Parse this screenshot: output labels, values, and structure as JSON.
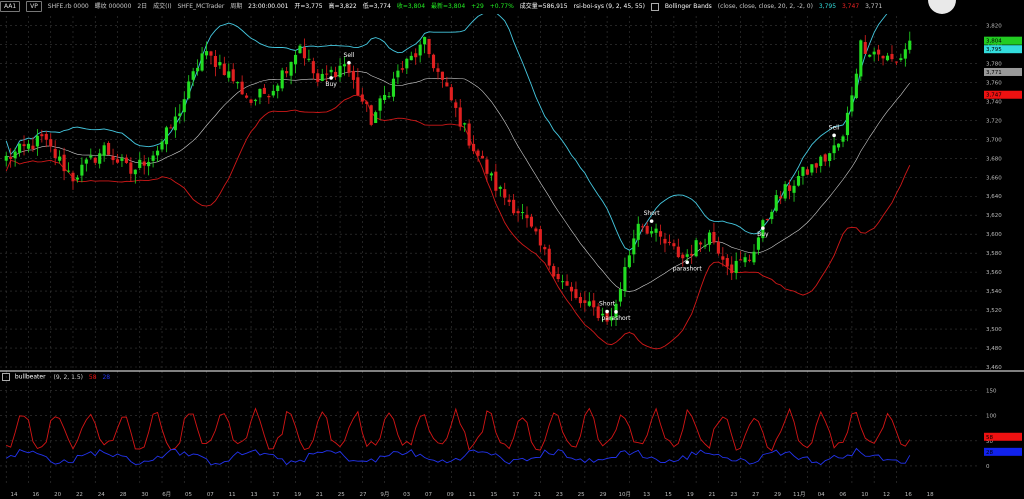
{
  "header": {
    "symbol_chip": "AA1",
    "vp_chip": "VP",
    "contract": "SHFE.rb 0000",
    "qty_label": "螺纹 000000",
    "period": "2日",
    "interval_label": "成交(I)",
    "exchange_feed": "SHFE_MCTrader",
    "cycle_label": "周期",
    "time": "23:00:00.001",
    "open": "开=3,775",
    "high": "高=3,822",
    "low": "低=3,774",
    "close": "收=3,804",
    "last": "最新=3,804",
    "change": "+29",
    "change_pct": "+0.77%",
    "volume": "成交量=586,915",
    "strategy": "rsi-boi-sys (9, 2, 45, 55)",
    "bb_name": "Bollinger Bands",
    "bb_params": "(close, close, close, 20, 2, -2, 0)",
    "bb_v1": "3,795",
    "bb_v2": "3,747",
    "bb_v3": "3,771"
  },
  "indicator": {
    "name": "bullbeater",
    "params": "(9, 2, 1.5)",
    "v1": "58",
    "v2": "28"
  },
  "colors": {
    "up": "#22dd22",
    "down": "#e02020",
    "upper_band": "#45c8e0",
    "lower_band": "#d01818",
    "mid_band": "#cfcfcf",
    "ind_red": "#d41515",
    "ind_blue": "#2233ee",
    "grid": "#3a3a3a"
  },
  "price_axis": {
    "ticks": [
      "3,820",
      "3,800",
      "3,780",
      "3,760",
      "3,740",
      "3,720",
      "3,700",
      "3,680",
      "3,660",
      "3,640",
      "3,620",
      "3,600",
      "3,580",
      "3,560",
      "3,540",
      "3,520",
      "3,500",
      "3,480",
      "3,460"
    ],
    "tags": [
      {
        "text": "3,804",
        "color": "#22cc22"
      },
      {
        "text": "3,795",
        "color": "#33dddd"
      },
      {
        "text": "3,771",
        "color": "#9a9a9a"
      },
      {
        "text": "3,747",
        "color": "#ee1111"
      }
    ]
  },
  "ind_axis": {
    "ticks": [
      "150",
      "100",
      "50",
      "0"
    ],
    "tags": [
      {
        "text": "58",
        "color": "#ee1111"
      },
      {
        "text": "28",
        "color": "#1122ee"
      }
    ]
  },
  "time_axis": [
    "14",
    "16",
    "20",
    "22",
    "24",
    "28",
    "30",
    "6月",
    "05",
    "07",
    "11",
    "13",
    "17",
    "19",
    "21",
    "25",
    "27",
    "9月",
    "03",
    "07",
    "09",
    "11",
    "15",
    "17",
    "21",
    "23",
    "25",
    "29",
    "10月",
    "13",
    "15",
    "19",
    "21",
    "23",
    "27",
    "29",
    "11月",
    "04",
    "06",
    "10",
    "12",
    "16",
    "18"
  ],
  "signals": [
    {
      "label": "Buy",
      "bar": 73,
      "pos": "below"
    },
    {
      "label": "Sell",
      "bar": 77,
      "pos": "above"
    },
    {
      "label": "Short",
      "bar": 135,
      "pos": "above"
    },
    {
      "label": "parashort",
      "bar": 137,
      "pos": "below"
    },
    {
      "label": "Short",
      "bar": 145,
      "pos": "above"
    },
    {
      "label": "parashort",
      "bar": 153,
      "pos": "below"
    },
    {
      "label": "Buy",
      "bar": 170,
      "pos": "below"
    },
    {
      "label": "Sell",
      "bar": 186,
      "pos": "above"
    }
  ],
  "chart_data": {
    "type": "candlestick",
    "price_range": [
      3460,
      3830
    ],
    "indicator_range": [
      -40,
      175
    ],
    "anchors_close": [
      [
        0,
        3680
      ],
      [
        8,
        3700
      ],
      [
        15,
        3660
      ],
      [
        22,
        3690
      ],
      [
        28,
        3665
      ],
      [
        34,
        3690
      ],
      [
        38,
        3720
      ],
      [
        44,
        3790
      ],
      [
        48,
        3780
      ],
      [
        55,
        3740
      ],
      [
        60,
        3755
      ],
      [
        66,
        3800
      ],
      [
        70,
        3760
      ],
      [
        76,
        3780
      ],
      [
        82,
        3720
      ],
      [
        88,
        3770
      ],
      [
        94,
        3800
      ],
      [
        98,
        3760
      ],
      [
        104,
        3700
      ],
      [
        110,
        3650
      ],
      [
        116,
        3620
      ],
      [
        122,
        3570
      ],
      [
        128,
        3530
      ],
      [
        132,
        3520
      ],
      [
        136,
        3510
      ],
      [
        142,
        3615
      ],
      [
        148,
        3590
      ],
      [
        152,
        3575
      ],
      [
        158,
        3600
      ],
      [
        163,
        3565
      ],
      [
        167,
        3575
      ],
      [
        172,
        3630
      ],
      [
        178,
        3660
      ],
      [
        184,
        3680
      ],
      [
        188,
        3700
      ],
      [
        192,
        3800
      ],
      [
        196,
        3790
      ],
      [
        200,
        3780
      ],
      [
        203,
        3804
      ]
    ]
  }
}
